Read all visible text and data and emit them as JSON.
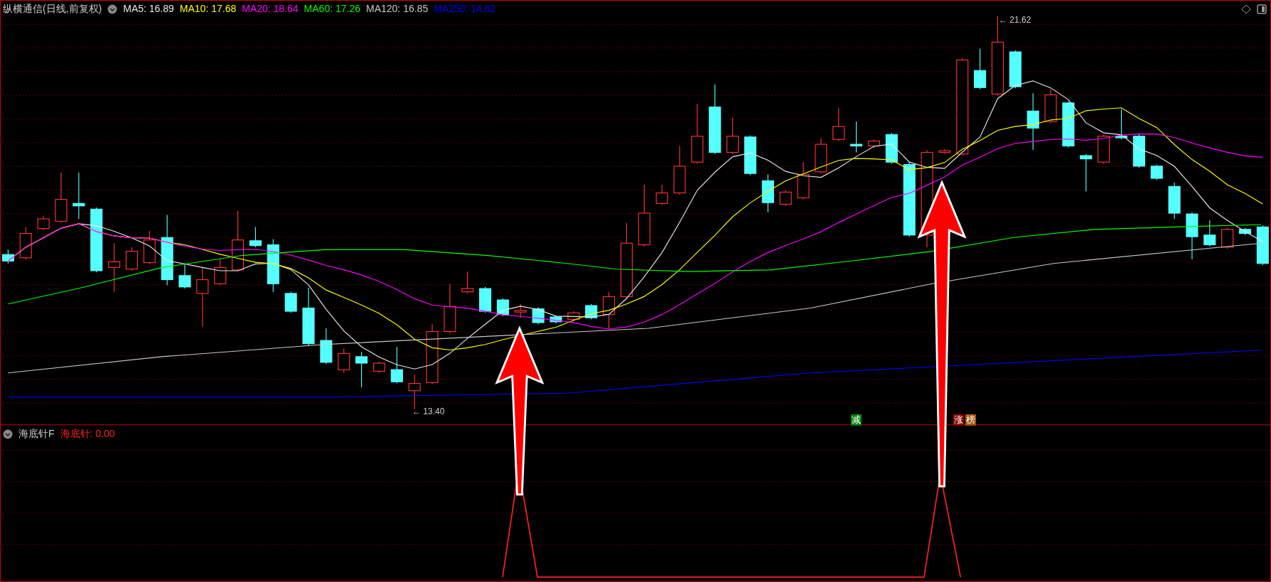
{
  "chart_title": "纵横通信(日线,前复权)",
  "moving_averages": [
    {
      "label": "MA5:",
      "value": "16.89",
      "color": "#e8e8e8"
    },
    {
      "label": "MA10:",
      "value": "17.68",
      "color": "#ffff00"
    },
    {
      "label": "MA20:",
      "value": "18.64",
      "color": "#ff00ff"
    },
    {
      "label": "MA60:",
      "value": "17.26",
      "color": "#00ff00"
    },
    {
      "label": "MA120:",
      "value": "16.85",
      "color": "#c8c8c8"
    },
    {
      "label": "MA250:",
      "value": "14.62",
      "color": "#0000ff"
    }
  ],
  "high_label": "← 21.62",
  "low_label": "← 13.40",
  "signal_tags": [
    {
      "text": "减",
      "color": "#008000"
    },
    {
      "text": "涨",
      "color": "#8b0000"
    },
    {
      "text": "榜",
      "color": "#a0520a"
    }
  ],
  "indicator": {
    "name": "海底针F",
    "line_label": "海底针:",
    "line_value": "0.00"
  }
}
